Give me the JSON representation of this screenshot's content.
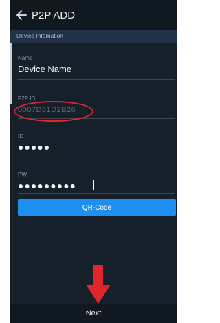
{
  "header": {
    "title": "P2P ADD"
  },
  "section": {
    "label": "Device Infomation"
  },
  "fields": {
    "name": {
      "label": "Name",
      "value": "Device Name"
    },
    "p2p_id": {
      "label": "P2P ID",
      "value": "0007D81D2B26"
    },
    "id": {
      "label": "ID",
      "value": "●●●●●"
    },
    "pw": {
      "label": "PW",
      "value": "●●●●●●●●●"
    }
  },
  "buttons": {
    "qr_code": "QR-Code",
    "next": "Next"
  },
  "colors": {
    "background": "#16202b",
    "topbar": "#101820",
    "section_bar": "#223349",
    "accent_button": "#1e8ff0",
    "annotation_red": "#e0252c"
  },
  "icons": {
    "back": "back-arrow-icon",
    "annotation": "down-arrow-annotation"
  }
}
